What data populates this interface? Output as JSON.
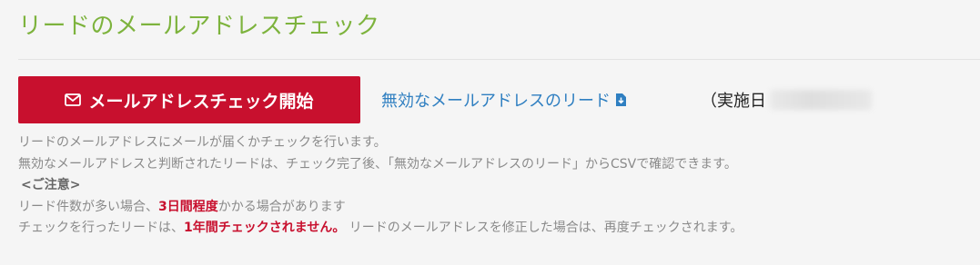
{
  "page": {
    "title": "リードのメールアドレスチェック"
  },
  "actions": {
    "start_button_label": "メールアドレスチェック開始",
    "invalid_leads_link": "無効なメールアドレスのリード",
    "exec_date_label": "（実施日"
  },
  "help": {
    "line1": "リードのメールアドレスにメールが届くかチェックを行います。",
    "line2": "無効なメールアドレスと判断されたリードは、チェック完了後、「無効なメールアドレスのリード」からCSVで確認できます。",
    "note_heading": "<ご注意>",
    "line3_a": "リード件数が多い場合、",
    "line3_b": "3日間程度",
    "line3_c": "かかる場合があります",
    "line4_a": "チェックを行ったリードは、",
    "line4_b": "1年間チェックされません。",
    "line4_c": " リードのメールアドレスを修正した場合は、再度チェックされます。"
  },
  "icons": {
    "start_button_icon": "envelope-icon",
    "link_icon": "file-download-icon"
  },
  "colors": {
    "title": "#7db33d",
    "button": "#c8102e",
    "link": "#2f7fc1",
    "warning": "#c8102e"
  }
}
